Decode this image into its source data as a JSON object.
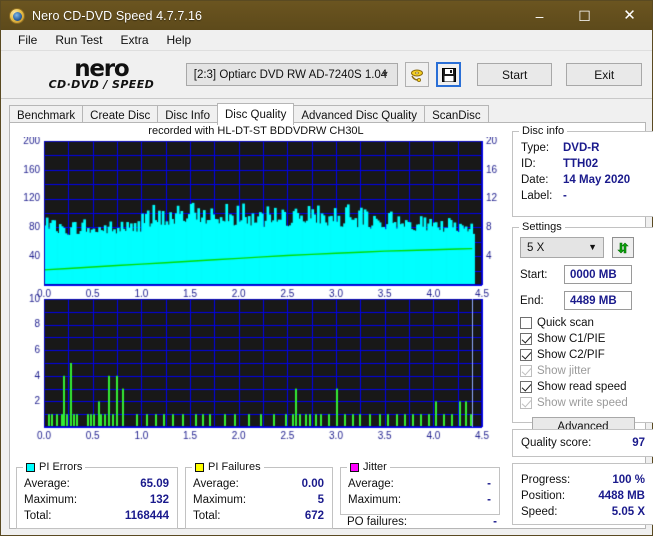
{
  "window": {
    "title": "Nero CD-DVD Speed 4.7.7.16",
    "icon": "nero-disc-icon",
    "minimize": "–",
    "maximize": "☐",
    "close": "✕"
  },
  "menu": {
    "items": [
      {
        "label": "File"
      },
      {
        "label": "Run Test"
      },
      {
        "label": "Extra"
      },
      {
        "label": "Help"
      }
    ]
  },
  "toolbar": {
    "logo_line1": "nero",
    "logo_line2": "CD·DVD ∕ SPEED",
    "drive": "[2:3]   Optiarc DVD RW AD-7240S 1.04",
    "eject_icon": "eject-disc-icon",
    "save_icon": "save-floppy-icon",
    "start_label": "Start",
    "exit_label": "Exit"
  },
  "tabs": [
    {
      "label": "Benchmark",
      "active": false
    },
    {
      "label": "Create Disc",
      "active": false
    },
    {
      "label": "Disc Info",
      "active": false
    },
    {
      "label": "Disc Quality",
      "active": true
    },
    {
      "label": "Advanced Disc Quality",
      "active": false
    },
    {
      "label": "ScanDisc",
      "active": false
    }
  ],
  "chart_title": "recorded with HL-DT-ST BDDVDRW CH30L",
  "disc_info": {
    "caption": "Disc info",
    "rows": [
      {
        "key": "Type:",
        "value": "DVD-R"
      },
      {
        "key": "ID:",
        "value": "TTH02"
      },
      {
        "key": "Date:",
        "value": "14 May 2020"
      },
      {
        "key": "Label:",
        "value": "-"
      }
    ]
  },
  "settings": {
    "caption": "Settings",
    "speed": "5 X",
    "refresh_icon": "refresh-arrows-icon",
    "start_label": "Start:",
    "start_value": "0000 MB",
    "end_label": "End:",
    "end_value": "4489 MB",
    "checkboxes": [
      {
        "label": "Quick scan",
        "checked": false,
        "enabled": true
      },
      {
        "label": "Show C1/PIE",
        "checked": true,
        "enabled": true
      },
      {
        "label": "Show C2/PIF",
        "checked": true,
        "enabled": true
      },
      {
        "label": "Show jitter",
        "checked": true,
        "enabled": false
      },
      {
        "label": "Show read speed",
        "checked": true,
        "enabled": true
      },
      {
        "label": "Show write speed",
        "checked": true,
        "enabled": false
      }
    ],
    "advanced_label": "Advanced"
  },
  "quality": {
    "label": "Quality score:",
    "value": "97"
  },
  "progress": {
    "rows": [
      {
        "key": "Progress:",
        "value": "100 %"
      },
      {
        "key": "Position:",
        "value": "4488 MB"
      },
      {
        "key": "Speed:",
        "value": "5.05 X"
      }
    ]
  },
  "stats": {
    "pi_errors": {
      "caption": "PI Errors",
      "color": "#00ffff",
      "rows": [
        {
          "key": "Average:",
          "value": "65.09"
        },
        {
          "key": "Maximum:",
          "value": "132"
        },
        {
          "key": "Total:",
          "value": "1168444"
        }
      ]
    },
    "pi_failures": {
      "caption": "PI Failures",
      "color": "#ffff00",
      "rows": [
        {
          "key": "Average:",
          "value": "0.00"
        },
        {
          "key": "Maximum:",
          "value": "5"
        },
        {
          "key": "Total:",
          "value": "672"
        }
      ]
    },
    "jitter": {
      "caption": "Jitter",
      "color": "#ff00ff",
      "rows": [
        {
          "key": "Average:",
          "value": "-"
        },
        {
          "key": "Maximum:",
          "value": "-"
        }
      ]
    },
    "po_failures": {
      "key": "PO failures:",
      "value": "-"
    }
  },
  "chart_data": [
    {
      "type": "area",
      "id": "pie-chart",
      "title": "recorded with HL-DT-ST BDDVDRW CH30L",
      "xlabel": "",
      "ylabel": "PI Errors",
      "xlim": [
        0,
        4.5
      ],
      "ylim": [
        0,
        200
      ],
      "yticks": [
        40,
        80,
        120,
        160,
        200
      ],
      "y2lim": [
        0,
        20
      ],
      "y2ticks": [
        4,
        8,
        12,
        16,
        20
      ],
      "xticks": [
        0.0,
        0.5,
        1.0,
        1.5,
        2.0,
        2.5,
        3.0,
        3.5,
        4.0,
        4.5
      ],
      "grid": true,
      "bg": "#181818",
      "gridcolor": "#0000ee",
      "data_end_x": 4.4,
      "series": [
        {
          "name": "PI Errors",
          "color": "#00ffff",
          "kind": "area",
          "x": [
            0.0,
            0.05,
            0.1,
            0.15,
            0.2,
            0.25,
            0.3,
            0.35,
            0.4,
            0.45,
            0.5,
            0.55,
            0.6,
            0.65,
            0.7,
            0.75,
            0.8,
            0.85,
            0.9,
            0.95,
            1.0,
            1.05,
            1.1,
            1.15,
            1.2,
            1.25,
            1.3,
            1.35,
            1.4,
            1.45,
            1.5,
            1.55,
            1.6,
            1.65,
            1.7,
            1.75,
            1.8,
            1.85,
            1.9,
            1.95,
            2.0,
            2.05,
            2.1,
            2.15,
            2.2,
            2.25,
            2.3,
            2.35,
            2.4,
            2.45,
            2.5,
            2.55,
            2.6,
            2.65,
            2.7,
            2.75,
            2.8,
            2.85,
            2.9,
            2.95,
            3.0,
            3.05,
            3.1,
            3.15,
            3.2,
            3.25,
            3.3,
            3.35,
            3.4,
            3.45,
            3.5,
            3.55,
            3.6,
            3.65,
            3.7,
            3.75,
            3.8,
            3.85,
            3.9,
            3.95,
            4.0,
            4.05,
            4.1,
            4.15,
            4.2,
            4.25,
            4.3,
            4.35,
            4.4
          ],
          "values": [
            74,
            72,
            70,
            73,
            71,
            69,
            72,
            70,
            74,
            71,
            68,
            73,
            70,
            72,
            69,
            71,
            74,
            72,
            70,
            73,
            75,
            78,
            80,
            82,
            79,
            84,
            81,
            86,
            83,
            88,
            85,
            90,
            87,
            84,
            89,
            86,
            83,
            88,
            85,
            82,
            87,
            84,
            81,
            86,
            83,
            80,
            85,
            82,
            79,
            84,
            81,
            86,
            83,
            88,
            85,
            82,
            87,
            84,
            81,
            86,
            83,
            80,
            85,
            82,
            79,
            84,
            81,
            78,
            83,
            80,
            77,
            82,
            79,
            76,
            81,
            78,
            75,
            80,
            77,
            74,
            79,
            76,
            73,
            78,
            75,
            72,
            77,
            74,
            71
          ],
          "peak_values": [
            95,
            88,
            92,
            86,
            90,
            84,
            94,
            88,
            96,
            90,
            86,
            92,
            88,
            94,
            86,
            90,
            98,
            92,
            88,
            96,
            100,
            104,
            108,
            110,
            106,
            112,
            108,
            116,
            110,
            118,
            112,
            120,
            114,
            110,
            118,
            112,
            108,
            116,
            110,
            106,
            114,
            110,
            104,
            112,
            108,
            102,
            110,
            106,
            100,
            108,
            104,
            112,
            106,
            116,
            110,
            104,
            114,
            108,
            102,
            112,
            106,
            100,
            110,
            104,
            98,
            108,
            102,
            96,
            106,
            100,
            94,
            104,
            98,
            92,
            102,
            96,
            90,
            100,
            94,
            88,
            98,
            92,
            86,
            96,
            90,
            84,
            94,
            88,
            84
          ]
        },
        {
          "name": "Read speed",
          "color": "#00dd00",
          "kind": "line",
          "axis": "right",
          "x": [
            0.0,
            0.25,
            0.5,
            0.75,
            1.0,
            1.25,
            1.5,
            1.75,
            2.0,
            2.25,
            2.5,
            2.75,
            3.0,
            3.25,
            3.5,
            3.75,
            4.0,
            4.25,
            4.4
          ],
          "values": [
            2.1,
            2.3,
            2.5,
            2.7,
            2.9,
            3.1,
            3.3,
            3.5,
            3.7,
            3.9,
            4.1,
            4.25,
            4.4,
            4.55,
            4.7,
            4.8,
            4.9,
            5.0,
            5.05
          ]
        }
      ]
    },
    {
      "type": "bar",
      "id": "pif-chart",
      "xlabel": "",
      "ylabel": "PI Failures",
      "xlim": [
        0,
        4.5
      ],
      "ylim": [
        0,
        10
      ],
      "yticks": [
        2,
        4,
        6,
        8,
        10
      ],
      "xticks": [
        0.0,
        0.5,
        1.0,
        1.5,
        2.0,
        2.5,
        3.0,
        3.5,
        4.0,
        4.5
      ],
      "grid": true,
      "bg": "#181818",
      "gridcolor": "#0000ee",
      "bar_color": "#33ee33",
      "data_end_x": 4.4,
      "x": [
        0.04,
        0.07,
        0.12,
        0.17,
        0.2,
        0.23,
        0.27,
        0.3,
        0.33,
        0.44,
        0.47,
        0.5,
        0.55,
        0.58,
        0.62,
        0.66,
        0.7,
        0.74,
        0.8,
        0.95,
        1.05,
        1.14,
        1.22,
        1.32,
        1.42,
        1.55,
        1.62,
        1.7,
        1.85,
        1.95,
        2.1,
        2.22,
        2.35,
        2.48,
        2.55,
        2.58,
        2.62,
        2.68,
        2.72,
        2.78,
        2.84,
        2.92,
        3.0,
        3.08,
        3.16,
        3.24,
        3.34,
        3.44,
        3.52,
        3.62,
        3.7,
        3.78,
        3.86,
        3.95,
        4.02,
        4.1,
        4.18,
        4.26,
        4.33,
        4.38
      ],
      "values": [
        1,
        1,
        1,
        1,
        4,
        1,
        5,
        1,
        1,
        1,
        1,
        1,
        2,
        1,
        1,
        4,
        1,
        4,
        3,
        1,
        1,
        1,
        1,
        1,
        1,
        1,
        1,
        1,
        1,
        1,
        1,
        1,
        1,
        1,
        1,
        3,
        1,
        1,
        1,
        1,
        1,
        1,
        3,
        1,
        1,
        1,
        1,
        1,
        1,
        1,
        1,
        1,
        1,
        1,
        2,
        1,
        1,
        2,
        2,
        1
      ]
    }
  ]
}
